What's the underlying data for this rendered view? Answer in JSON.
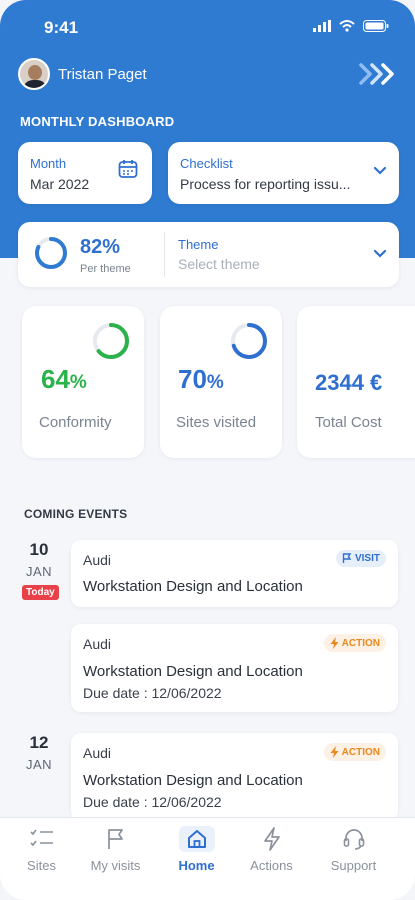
{
  "status": {
    "time": "9:41"
  },
  "user": {
    "name": "Tristan Paget"
  },
  "section_title": "MONTHLY DASHBOARD",
  "filters": {
    "month": {
      "label": "Month",
      "value": "Mar 2022"
    },
    "checklist": {
      "label": "Checklist",
      "value": "Process for reporting issu..."
    },
    "theme": {
      "percent": "82%",
      "percent_caption": "Per theme",
      "label": "Theme",
      "placeholder": "Select theme",
      "progress": 0.82
    }
  },
  "stats": [
    {
      "value": "64",
      "unit": "%",
      "caption": "Conformity",
      "progress": 0.64,
      "color": "#2bb24a"
    },
    {
      "value": "70",
      "unit": "%",
      "caption": "Sites visited",
      "progress": 0.7,
      "color": "#2f6fd0"
    },
    {
      "value": "2344 €",
      "unit": "",
      "caption": "Total Cost"
    }
  ],
  "events_title": "COMING EVENTS",
  "dates": [
    {
      "day": "10",
      "month": "JAN",
      "today": "Today"
    },
    {
      "day": "12",
      "month": "JAN"
    }
  ],
  "events": [
    {
      "company": "Audi",
      "badge": "VISIT",
      "title": "Workstation Design and Location"
    },
    {
      "company": "Audi",
      "badge": "ACTION",
      "title": "Workstation Design and Location",
      "due": "Due date : 12/06/2022"
    },
    {
      "company": "Audi",
      "badge": "ACTION",
      "title": "Workstation Design and Location",
      "due": "Due date : 12/06/2022"
    }
  ],
  "tabs": [
    {
      "label": "Sites",
      "icon": "checklist-icon"
    },
    {
      "label": "My visits",
      "icon": "flag-icon"
    },
    {
      "label": "Home",
      "icon": "home-icon",
      "active": true
    },
    {
      "label": "Actions",
      "icon": "lightning-icon"
    },
    {
      "label": "Support",
      "icon": "headset-icon"
    }
  ],
  "colors": {
    "primary": "#2f7bd1",
    "success": "#2bb24a",
    "danger": "#e9414a",
    "warning": "#e8891e"
  }
}
